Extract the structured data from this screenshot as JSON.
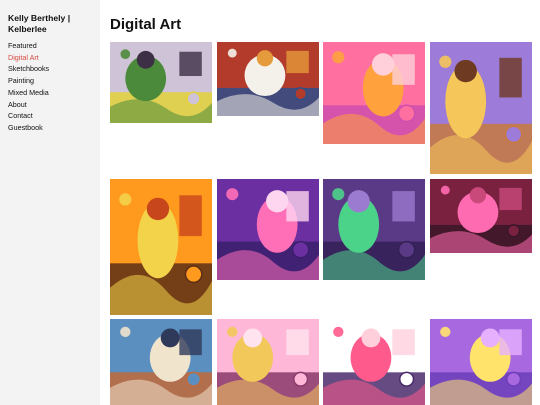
{
  "site": {
    "title_line1": "Kelly Berthely |",
    "title_line2": "Kelberlee"
  },
  "nav": {
    "items": [
      {
        "label": "Featured",
        "active": false
      },
      {
        "label": "Digital Art",
        "active": true
      },
      {
        "label": "Sketchbooks",
        "active": false
      },
      {
        "label": "Painting",
        "active": false
      },
      {
        "label": "Mixed Media",
        "active": false
      },
      {
        "label": "About",
        "active": false
      },
      {
        "label": "Contact",
        "active": false
      },
      {
        "label": "Guestbook",
        "active": false
      }
    ]
  },
  "page": {
    "title": "Digital Art"
  },
  "colors": {
    "sidebar_bg": "#f3f3f3",
    "active_nav": "#d44a40",
    "text": "#111111"
  },
  "gallery": {
    "artworks": [
      {
        "name": "artwork-green-figures",
        "palette": [
          "#cfc3d8",
          "#4b8a3a",
          "#e3d23a",
          "#3c2f46"
        ]
      },
      {
        "name": "artwork-domed-city",
        "palette": [
          "#b33b2b",
          "#f4f1ea",
          "#2e4f8a",
          "#e59a3b"
        ]
      },
      {
        "name": "artwork-pink-window-room",
        "palette": [
          "#ff6fa0",
          "#ffa23d",
          "#cf4fae",
          "#ffd0d9"
        ]
      },
      {
        "name": "artwork-curly-hair-woman",
        "palette": [
          "#9d7bd8",
          "#f5c75a",
          "#c87a3f",
          "#6f3a22"
        ]
      },
      {
        "name": "artwork-orange-garden",
        "palette": [
          "#ff9a1f",
          "#f3d34a",
          "#5c2f15",
          "#c8461b"
        ]
      },
      {
        "name": "artwork-purple-cat-figure",
        "palette": [
          "#6b2fa1",
          "#ff6fb8",
          "#3a1f6b",
          "#ffd6f0"
        ]
      },
      {
        "name": "artwork-green-witch",
        "palette": [
          "#5a3a86",
          "#4cd38a",
          "#332055",
          "#9b7bd0"
        ]
      },
      {
        "name": "artwork-pink-hair-girl",
        "palette": [
          "#7a2140",
          "#ff6bb0",
          "#3b1628",
          "#c94a7a"
        ]
      },
      {
        "name": "artwork-dog-scene",
        "palette": [
          "#5b8fc0",
          "#f0e4cc",
          "#c26a3a",
          "#2f3a5a"
        ]
      },
      {
        "name": "artwork-veiled-figure",
        "palette": [
          "#ffb7d8",
          "#f2c85a",
          "#8a3a6b",
          "#ffe3ef"
        ]
      },
      {
        "name": "artwork-flower-hair-head",
        "palette": [
          "#ffffff",
          "#ff5a8c",
          "#4a2b6b",
          "#ffd0dc"
        ]
      },
      {
        "name": "artwork-purple-palm",
        "palette": [
          "#a869e0",
          "#ffe36b",
          "#6c3fb8",
          "#e7b0ff"
        ]
      }
    ]
  }
}
